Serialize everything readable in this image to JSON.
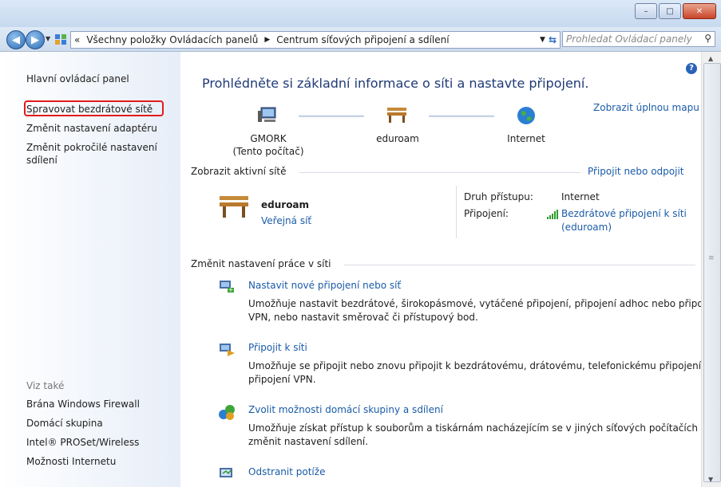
{
  "window": {
    "minimize": "–",
    "maximize": "□",
    "close": "✕"
  },
  "address": {
    "chevrons": "«",
    "crumb1": "Všechny položky Ovládacích panelů",
    "sep": "▶",
    "crumb2": "Centrum síťových připojení a sdílení"
  },
  "search": {
    "placeholder": "Prohledat Ovládací panely"
  },
  "sidebar": {
    "items": [
      {
        "label": "Hlavní ovládací panel"
      },
      {
        "label": "Spravovat bezdrátové sítě"
      },
      {
        "label": "Změnit nastavení adaptéru"
      },
      {
        "label": "Změnit pokročilé nastavení"
      },
      {
        "label": "sdílení"
      }
    ],
    "see_also": "Viz také",
    "see_items": [
      "Brána Windows Firewall",
      "Domácí skupina",
      "Intel® PROSet/Wireless",
      "Možnosti Internetu"
    ]
  },
  "main": {
    "heading": "Prohlédněte si základní informace o síti a nastavte připojení.",
    "full_map": "Zobrazit úplnou mapu",
    "nodes": [
      {
        "name": "GMORK",
        "sub": "(Tento počítač)"
      },
      {
        "name": "eduroam",
        "sub": ""
      },
      {
        "name": "Internet",
        "sub": ""
      }
    ],
    "active_title": "Zobrazit aktivní sítě",
    "connect_link": "Připojit nebo odpojit",
    "network_name": "eduroam",
    "network_type": "Veřejná síť",
    "access_label": "Druh přístupu:",
    "access_value": "Internet",
    "conn_label": "Připojení:",
    "conn_value1": "Bezdrátové připojení k síti",
    "conn_value2": "(eduroam)",
    "change_title": "Změnit nastavení práce v síti",
    "tasks": [
      {
        "title": "Nastavit nové připojení nebo síť",
        "desc1": "Umožňuje nastavit bezdrátové, širokopásmové, vytáčené připojení, připojení adhoc nebo připojení",
        "desc2": "VPN, nebo nastavit směrovač či přístupový bod."
      },
      {
        "title": "Připojit k síti",
        "desc1": "Umožňuje se připojit nebo znovu připojit k bezdrátovému, drátovému, telefonickému připojení či",
        "desc2": "připojení VPN."
      },
      {
        "title": "Zvolit možnosti domácí skupiny a sdílení",
        "desc1": "Umožňuje získat přístup k souborům a tiskárnám nacházejícím se v jiných síťových počítačích nebo",
        "desc2": "změnit nastavení sdílení."
      },
      {
        "title": "Odstranit potíže",
        "desc1": "",
        "desc2": ""
      }
    ]
  }
}
